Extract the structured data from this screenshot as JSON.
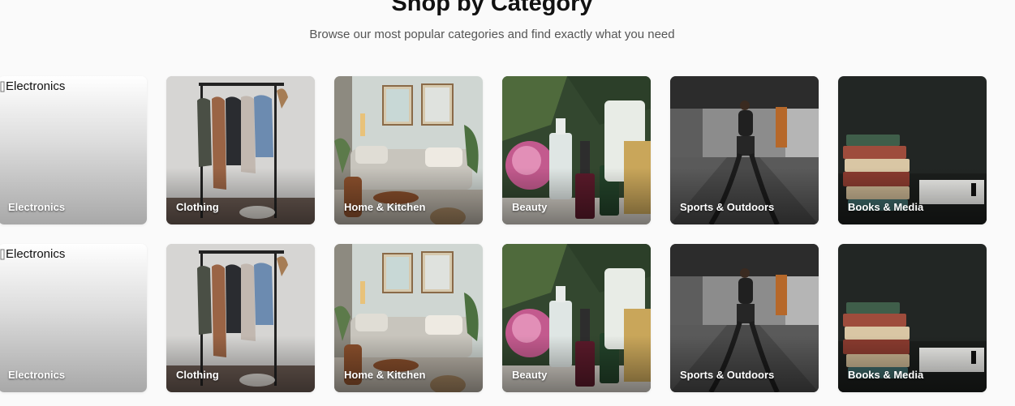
{
  "header": {
    "title": "Shop by Category",
    "subtitle": "Browse our most popular categories and find exactly what you need"
  },
  "rows": [
    {
      "cards": [
        {
          "key": "electronics",
          "label": "Electronics",
          "alt": "Electronics",
          "image_loaded": false
        },
        {
          "key": "clothing",
          "label": "Clothing",
          "image_loaded": true
        },
        {
          "key": "home",
          "label": "Home & Kitchen",
          "image_loaded": true
        },
        {
          "key": "beauty",
          "label": "Beauty",
          "image_loaded": true
        },
        {
          "key": "sports",
          "label": "Sports & Outdoors",
          "image_loaded": true
        },
        {
          "key": "books",
          "label": "Books & Media",
          "image_loaded": true
        }
      ]
    },
    {
      "cards": [
        {
          "key": "electronics",
          "label": "Electronics",
          "alt": "Electronics",
          "image_loaded": false
        },
        {
          "key": "clothing",
          "label": "Clothing",
          "image_loaded": true
        },
        {
          "key": "home",
          "label": "Home & Kitchen",
          "image_loaded": true
        },
        {
          "key": "beauty",
          "label": "Beauty",
          "image_loaded": true
        },
        {
          "key": "sports",
          "label": "Sports & Outdoors",
          "image_loaded": true
        },
        {
          "key": "books",
          "label": "Books & Media",
          "image_loaded": true
        }
      ]
    }
  ]
}
